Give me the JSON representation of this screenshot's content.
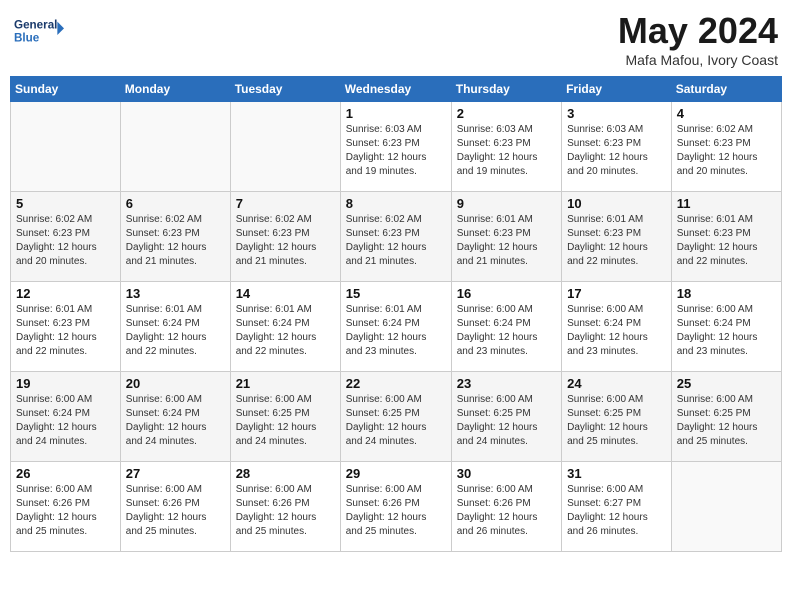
{
  "header": {
    "logo_line1": "General",
    "logo_line2": "Blue",
    "title": "May 2024",
    "location": "Mafa Mafou, Ivory Coast"
  },
  "weekdays": [
    "Sunday",
    "Monday",
    "Tuesday",
    "Wednesday",
    "Thursday",
    "Friday",
    "Saturday"
  ],
  "weeks": [
    [
      {
        "day": "",
        "info": ""
      },
      {
        "day": "",
        "info": ""
      },
      {
        "day": "",
        "info": ""
      },
      {
        "day": "1",
        "info": "Sunrise: 6:03 AM\nSunset: 6:23 PM\nDaylight: 12 hours and 19 minutes."
      },
      {
        "day": "2",
        "info": "Sunrise: 6:03 AM\nSunset: 6:23 PM\nDaylight: 12 hours and 19 minutes."
      },
      {
        "day": "3",
        "info": "Sunrise: 6:03 AM\nSunset: 6:23 PM\nDaylight: 12 hours and 20 minutes."
      },
      {
        "day": "4",
        "info": "Sunrise: 6:02 AM\nSunset: 6:23 PM\nDaylight: 12 hours and 20 minutes."
      }
    ],
    [
      {
        "day": "5",
        "info": "Sunrise: 6:02 AM\nSunset: 6:23 PM\nDaylight: 12 hours and 20 minutes."
      },
      {
        "day": "6",
        "info": "Sunrise: 6:02 AM\nSunset: 6:23 PM\nDaylight: 12 hours and 21 minutes."
      },
      {
        "day": "7",
        "info": "Sunrise: 6:02 AM\nSunset: 6:23 PM\nDaylight: 12 hours and 21 minutes."
      },
      {
        "day": "8",
        "info": "Sunrise: 6:02 AM\nSunset: 6:23 PM\nDaylight: 12 hours and 21 minutes."
      },
      {
        "day": "9",
        "info": "Sunrise: 6:01 AM\nSunset: 6:23 PM\nDaylight: 12 hours and 21 minutes."
      },
      {
        "day": "10",
        "info": "Sunrise: 6:01 AM\nSunset: 6:23 PM\nDaylight: 12 hours and 22 minutes."
      },
      {
        "day": "11",
        "info": "Sunrise: 6:01 AM\nSunset: 6:23 PM\nDaylight: 12 hours and 22 minutes."
      }
    ],
    [
      {
        "day": "12",
        "info": "Sunrise: 6:01 AM\nSunset: 6:23 PM\nDaylight: 12 hours and 22 minutes."
      },
      {
        "day": "13",
        "info": "Sunrise: 6:01 AM\nSunset: 6:24 PM\nDaylight: 12 hours and 22 minutes."
      },
      {
        "day": "14",
        "info": "Sunrise: 6:01 AM\nSunset: 6:24 PM\nDaylight: 12 hours and 22 minutes."
      },
      {
        "day": "15",
        "info": "Sunrise: 6:01 AM\nSunset: 6:24 PM\nDaylight: 12 hours and 23 minutes."
      },
      {
        "day": "16",
        "info": "Sunrise: 6:00 AM\nSunset: 6:24 PM\nDaylight: 12 hours and 23 minutes."
      },
      {
        "day": "17",
        "info": "Sunrise: 6:00 AM\nSunset: 6:24 PM\nDaylight: 12 hours and 23 minutes."
      },
      {
        "day": "18",
        "info": "Sunrise: 6:00 AM\nSunset: 6:24 PM\nDaylight: 12 hours and 23 minutes."
      }
    ],
    [
      {
        "day": "19",
        "info": "Sunrise: 6:00 AM\nSunset: 6:24 PM\nDaylight: 12 hours and 24 minutes."
      },
      {
        "day": "20",
        "info": "Sunrise: 6:00 AM\nSunset: 6:24 PM\nDaylight: 12 hours and 24 minutes."
      },
      {
        "day": "21",
        "info": "Sunrise: 6:00 AM\nSunset: 6:25 PM\nDaylight: 12 hours and 24 minutes."
      },
      {
        "day": "22",
        "info": "Sunrise: 6:00 AM\nSunset: 6:25 PM\nDaylight: 12 hours and 24 minutes."
      },
      {
        "day": "23",
        "info": "Sunrise: 6:00 AM\nSunset: 6:25 PM\nDaylight: 12 hours and 24 minutes."
      },
      {
        "day": "24",
        "info": "Sunrise: 6:00 AM\nSunset: 6:25 PM\nDaylight: 12 hours and 25 minutes."
      },
      {
        "day": "25",
        "info": "Sunrise: 6:00 AM\nSunset: 6:25 PM\nDaylight: 12 hours and 25 minutes."
      }
    ],
    [
      {
        "day": "26",
        "info": "Sunrise: 6:00 AM\nSunset: 6:26 PM\nDaylight: 12 hours and 25 minutes."
      },
      {
        "day": "27",
        "info": "Sunrise: 6:00 AM\nSunset: 6:26 PM\nDaylight: 12 hours and 25 minutes."
      },
      {
        "day": "28",
        "info": "Sunrise: 6:00 AM\nSunset: 6:26 PM\nDaylight: 12 hours and 25 minutes."
      },
      {
        "day": "29",
        "info": "Sunrise: 6:00 AM\nSunset: 6:26 PM\nDaylight: 12 hours and 25 minutes."
      },
      {
        "day": "30",
        "info": "Sunrise: 6:00 AM\nSunset: 6:26 PM\nDaylight: 12 hours and 26 minutes."
      },
      {
        "day": "31",
        "info": "Sunrise: 6:00 AM\nSunset: 6:27 PM\nDaylight: 12 hours and 26 minutes."
      },
      {
        "day": "",
        "info": ""
      }
    ]
  ],
  "colors": {
    "header_bg": "#2a6ebb",
    "header_text": "#ffffff"
  }
}
